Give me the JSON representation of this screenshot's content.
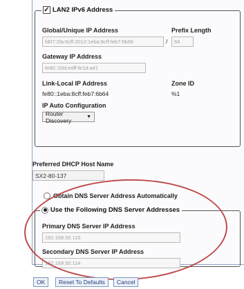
{
  "lan2_ipv6": {
    "legend": "LAN2 IPv6 Address",
    "checked": true,
    "global_label": "Global/Unique IP Address",
    "global_value": "fd07:2fa:6cff:2012:1eba:8cff:feb7:6b66",
    "prefix_label": "Prefix Length",
    "prefix_value": "64",
    "gateway_label": "Gateway IP Address",
    "gateway_value": "fe80::20d:edff:fe1d:a41",
    "linklocal_label": "Link-Local IP Address",
    "linklocal_value": "fe80::1eba:8cff:feb7:6b64",
    "zone_label": "Zone ID",
    "zone_value": "%1",
    "autoconf_label": "IP Auto Configuration",
    "autoconf_value": "Router Discovery"
  },
  "dhcp": {
    "label": "Preferred DHCP Host Name",
    "value": "SX2-80-137"
  },
  "dns": {
    "auto_label": "Obtain DNS Server Address Automatically",
    "manual_label": "Use the Following DNS Server Addresses",
    "selected": "manual",
    "primary_label": "Primary DNS Server IP Address",
    "primary_value": "192.168.50.116",
    "secondary_label": "Secondary DNS Server IP Address",
    "secondary_value": "192.168.50.114"
  },
  "buttons": {
    "ok": "OK",
    "reset": "Reset To Defaults",
    "cancel": "Cancel"
  },
  "colors": {
    "highlight": "#b83838",
    "button_text": "#1d3d80"
  }
}
